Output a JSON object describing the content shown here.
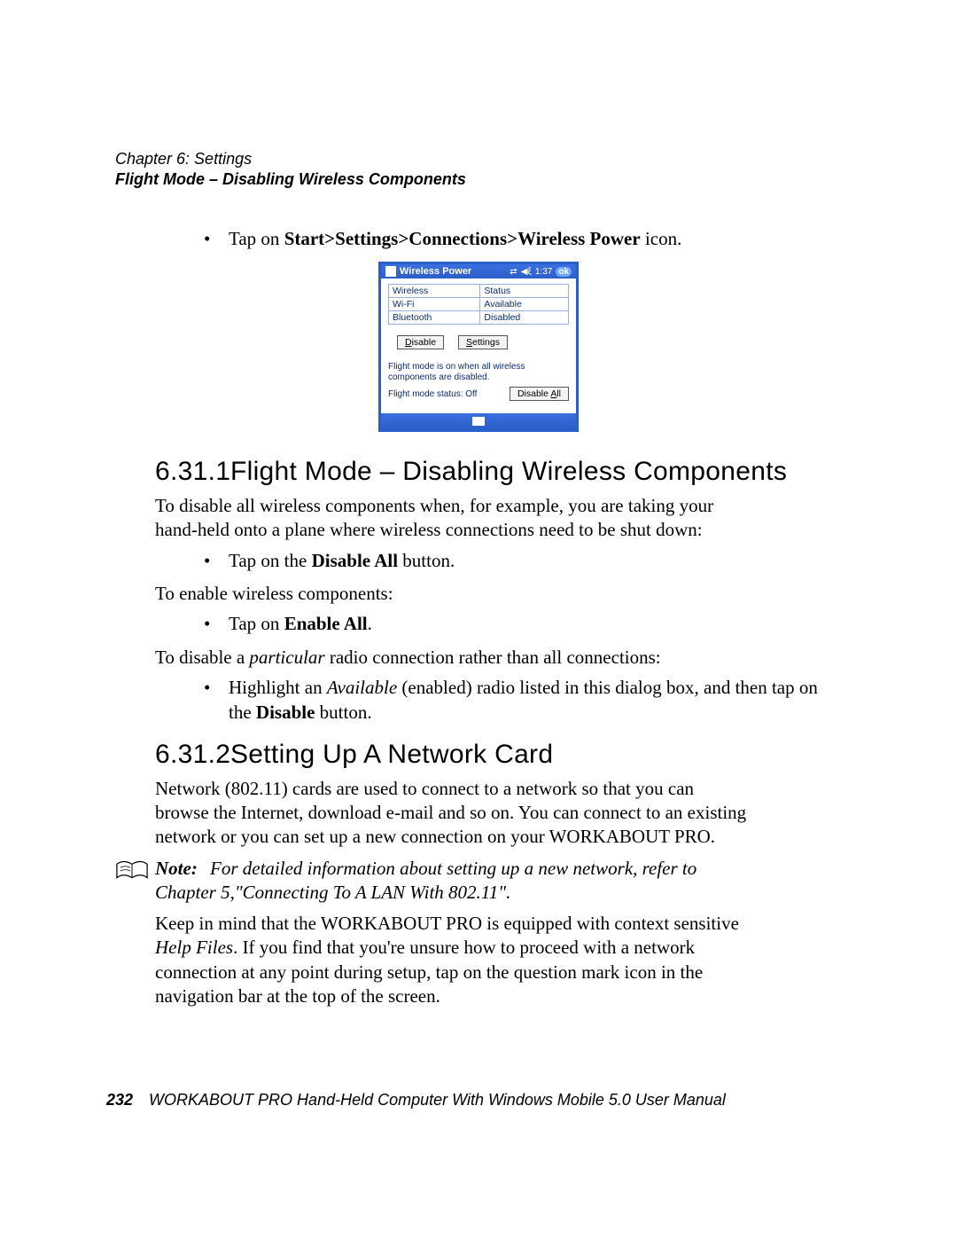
{
  "header": {
    "chapter": "Chapter 6:  Settings",
    "subtitle": "Flight Mode – Disabling Wireless Components"
  },
  "intro_bullet": {
    "pre": "Tap on ",
    "bold": "Start>Settings>Connections>Wireless Power",
    "post": " icon."
  },
  "screenshot": {
    "title": "Wireless Power",
    "time": "1:37",
    "ok": "ok",
    "col_wireless": "Wireless",
    "col_status": "Status",
    "row1_name": "Wi-Fi",
    "row1_status": "Available",
    "row2_name": "Bluetooth",
    "row2_status": "Disabled",
    "btn_disable_u": "D",
    "btn_disable_rest": "isable",
    "btn_settings_u": "S",
    "btn_settings_rest": "ettings",
    "flight_note": "Flight mode is on when all wireless components are disabled.",
    "status_label": "Flight mode status: Off",
    "btn_disable_all_pre": "Disable ",
    "btn_disable_all_u": "A",
    "btn_disable_all_post": "ll"
  },
  "s1": {
    "num": "6.31.1",
    "title": "Flight Mode – Disabling Wireless Components",
    "p1": "To disable all wireless components when, for example, you are taking your hand-held onto a plane where wireless connections need to be shut down:",
    "b1_pre": "Tap on the ",
    "b1_bold": "Disable All",
    "b1_post": " button.",
    "p2": "To enable wireless components:",
    "b2_pre": "Tap on ",
    "b2_bold": "Enable All",
    "b2_post": ".",
    "p3_pre": "To disable a ",
    "p3_it": "particular",
    "p3_post": " radio connection rather than all connections:",
    "b3_pre": "Highlight an ",
    "b3_it": "Available",
    "b3_mid": " (enabled) radio listed in this dialog box, and then tap on the ",
    "b3_bold": "Disable",
    "b3_post": " button."
  },
  "s2": {
    "num": "6.31.2",
    "title": "Setting Up A Network Card",
    "p1": "Network (802.11) cards are used to connect to a network so that you can browse the Internet, download e-mail and so on. You can connect to an existing network or you can set up a new connection on your WORKABOUT PRO.",
    "note_label": "Note:",
    "note_text": "For detailed information about setting up a new network, refer to Chapter 5,\"Connecting To A LAN With 802.11\".",
    "p2_pre": "Keep in mind that the WORKABOUT PRO is equipped with context sensitive ",
    "p2_it": "Help Files",
    "p2_post": ". If you find that you're unsure how to proceed with a network connection at any point during setup, tap on the question mark icon in the navigation bar at the top of the screen."
  },
  "footer": {
    "page": "232",
    "text": "WORKABOUT PRO Hand-Held Computer With Windows Mobile 5.0 User Manual"
  }
}
